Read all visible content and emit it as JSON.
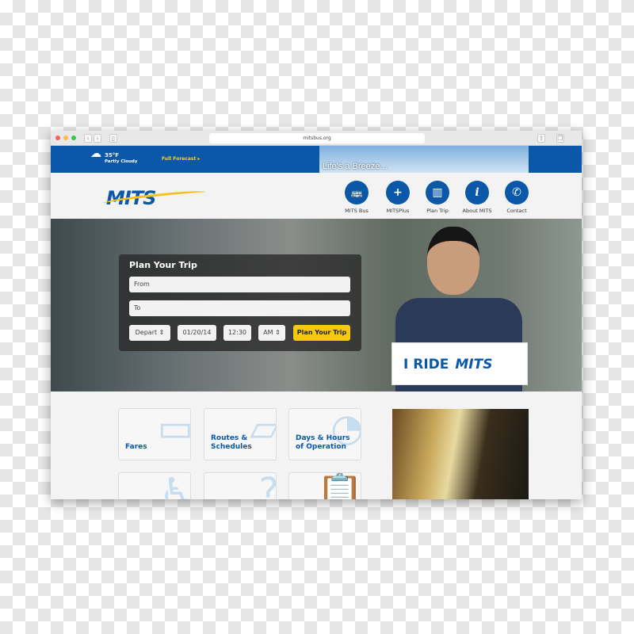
{
  "browser": {
    "url": "mitsbus.org"
  },
  "topbar": {
    "temperature": "35°F",
    "condition": "Partly Cloudy",
    "forecast_link": "Full Forecast ▸",
    "banner_text": "Life's a Breeze..."
  },
  "header": {
    "logo": "MITS",
    "nav": [
      {
        "label": "MITS Bus",
        "icon": "bus-icon",
        "glyph": "🚌"
      },
      {
        "label": "MITSPlus",
        "icon": "bus-plus-icon",
        "glyph": "+"
      },
      {
        "label": "Plan Trip",
        "icon": "map-icon",
        "glyph": "▥"
      },
      {
        "label": "About MITS",
        "icon": "info-icon",
        "glyph": "i"
      },
      {
        "label": "Contact",
        "icon": "phone-icon",
        "glyph": "✆"
      }
    ]
  },
  "trip": {
    "title": "Plan Your Trip",
    "from_placeholder": "From",
    "to_placeholder": "To",
    "mode": "Depart ⇕",
    "date": "01/20/14",
    "time": "12:30",
    "ampm": "AM ⇕",
    "submit": "Plan Your Trip"
  },
  "hero": {
    "sign_text": "I RIDE",
    "sign_logo": "MITS"
  },
  "tiles": [
    {
      "label": "Fares",
      "glyph": "▭"
    },
    {
      "label": "Routes & Schedules",
      "glyph": "▱"
    },
    {
      "label": "Days & Hours of Operation",
      "glyph": "◔"
    },
    {
      "label": "",
      "glyph": "♿"
    },
    {
      "label": "",
      "glyph": "?"
    },
    {
      "label": "",
      "glyph": "📋"
    }
  ],
  "colors": {
    "brand_blue": "#0b57a8",
    "accent_yellow": "#f6c90e"
  }
}
